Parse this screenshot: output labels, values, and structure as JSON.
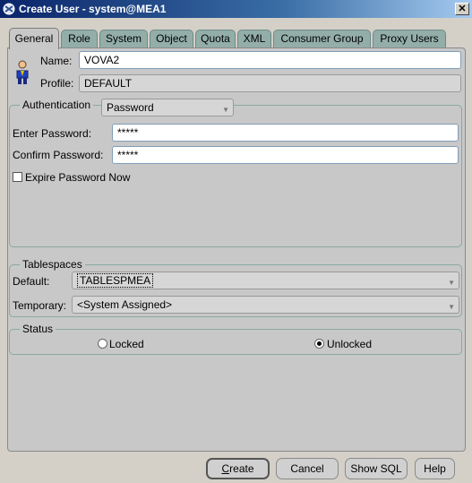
{
  "window": {
    "title": "Create User - system@MEA1",
    "close_glyph": "✕"
  },
  "tabs": [
    {
      "label": "General",
      "active": true
    },
    {
      "label": "Role"
    },
    {
      "label": "System"
    },
    {
      "label": "Object"
    },
    {
      "label": "Quota"
    },
    {
      "label": "XML"
    },
    {
      "label": "Consumer Group"
    },
    {
      "label": "Proxy Users"
    }
  ],
  "general": {
    "user_icon": "user-icon",
    "name_label": "Name:",
    "name_value": "VOVA2",
    "profile_label": "Profile:",
    "profile_value": "DEFAULT"
  },
  "authentication": {
    "legend": "Authentication",
    "type_value": "Password",
    "enter_password_label": "Enter Password:",
    "enter_password_value": "*****",
    "confirm_password_label": "Confirm Password:",
    "confirm_password_value": "*****",
    "expire_label": "Expire Password Now",
    "expire_checked": false
  },
  "tablespaces": {
    "legend": "Tablespaces",
    "default_label": "Default:",
    "default_value": "TABLESPMEA",
    "temporary_label": "Temporary:",
    "temporary_value": "<System Assigned>"
  },
  "status": {
    "legend": "Status",
    "locked_label": "Locked",
    "unlocked_label": "Unlocked",
    "selected": "Unlocked"
  },
  "buttons": {
    "create_mnemonic": "C",
    "create_rest": "reate",
    "cancel": "Cancel",
    "show_sql": "Show SQL",
    "help": "Help"
  },
  "colors": {
    "title_gradient_start": "#0a246a",
    "tab_inactive": "#93aea9",
    "panel": "#c8c8c8"
  }
}
